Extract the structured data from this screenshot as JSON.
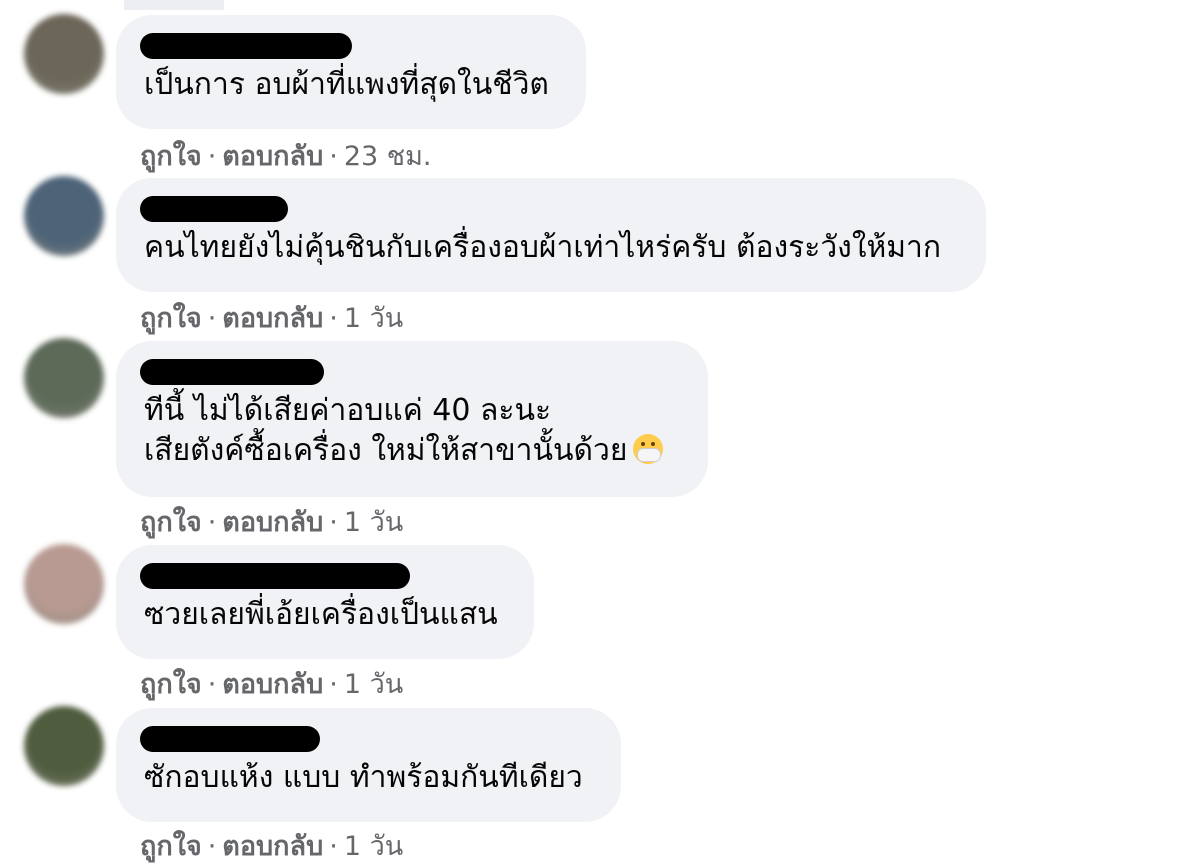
{
  "comments": [
    {
      "text": "เป็นการ อบผ้าที่แพงที่สุดในชีวิต",
      "like_label": "ถูกใจ",
      "reply_label": "ตอบกลับ",
      "time": "23 ชม.",
      "avatar_color": "#6b6658"
    },
    {
      "text": "คนไทยยังไม่คุ้นชินกับเครื่องอบผ้าเท่าไหร่ครับ ต้องระวังให้มาก",
      "like_label": "ถูกใจ",
      "reply_label": "ตอบกลับ",
      "time": "1 วัน",
      "avatar_color": "#4d6378"
    },
    {
      "text": "ทีนี้ ไม่ได้เสียค่าอบแค่ 40 ละนะ\nเสียตังค์ซื้อเครื่อง ใหม่ให้สาขานั้นด้วย",
      "emoji": "face-with-medical-mask-emoji",
      "like_label": "ถูกใจ",
      "reply_label": "ตอบกลับ",
      "time": "1 วัน",
      "avatar_color": "#5d6a58"
    },
    {
      "text": "ซวยเลยพี่เอ้ยเครื่องเป็นแสน",
      "like_label": "ถูกใจ",
      "reply_label": "ตอบกลับ",
      "time": "1 วัน",
      "avatar_color": "#b89a92"
    },
    {
      "text": "ซักอบแห้ง แบบ ทำพร้อมกันทีเดียว",
      "like_label": "ถูกใจ",
      "reply_label": "ตอบกลับ",
      "time": "1 วัน",
      "avatar_color": "#4f5c3e"
    }
  ]
}
